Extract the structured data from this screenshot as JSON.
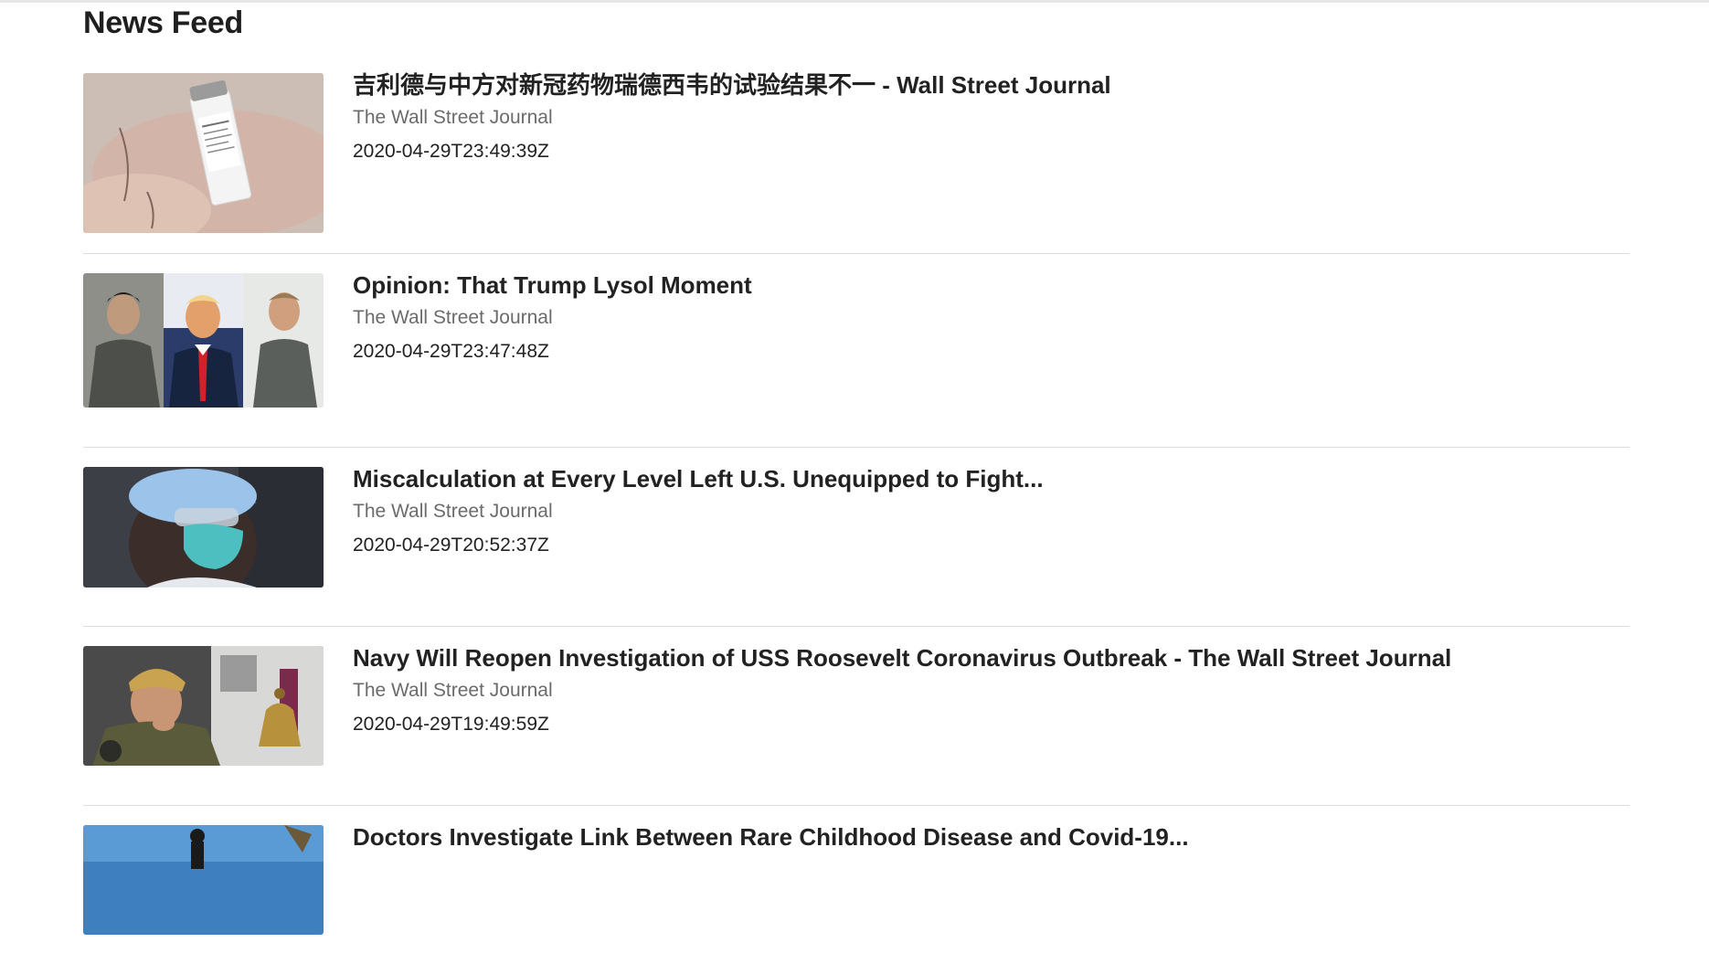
{
  "page": {
    "title": "News Feed"
  },
  "articles": [
    {
      "title": "吉利德与中方对新冠药物瑞德西韦的试验结果不一 - Wall Street Journal",
      "source": "The Wall Street Journal",
      "published": "2020-04-29T23:49:39Z",
      "thumbnail": "medicine-vial-in-hand"
    },
    {
      "title": "Opinion: That Trump Lysol Moment",
      "source": "The Wall Street Journal",
      "published": "2020-04-29T23:47:48Z",
      "thumbnail": "three-portraits"
    },
    {
      "title": "Miscalculation at Every Level Left U.S. Unequipped to Fight...",
      "source": "The Wall Street Journal",
      "published": "2020-04-29T20:52:37Z",
      "thumbnail": "health-worker-in-mask"
    },
    {
      "title": "Navy Will Reopen Investigation of USS Roosevelt Coronavirus Outbreak - The Wall Street Journal",
      "source": "The Wall Street Journal",
      "published": "2020-04-29T19:49:59Z",
      "thumbnail": "navy-officer-with-bell"
    },
    {
      "title": "Doctors Investigate Link Between Rare Childhood Disease and Covid-19...",
      "source": "",
      "published": "",
      "thumbnail": "outdoor-scene"
    }
  ]
}
